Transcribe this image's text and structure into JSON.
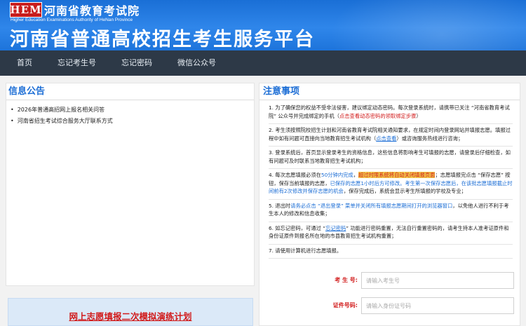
{
  "header": {
    "logo_text": "HEM",
    "org_name": "河南省教育考试院",
    "org_en": "Higher Education Examinations Authority of HeNan Province",
    "platform_title": "河南省普通高校招生考生服务平台"
  },
  "nav": {
    "items": [
      {
        "label": "首页"
      },
      {
        "label": "忘记考生号"
      },
      {
        "label": "忘记密码"
      },
      {
        "label": "微信公众号"
      }
    ]
  },
  "notices": {
    "title": "信息公告",
    "items": [
      {
        "label": "2026年普通高招网上报名相关问答"
      },
      {
        "label": "河南省招生考试综合服务大厅联系方式"
      }
    ]
  },
  "drill": {
    "label": "网上志愿填报二次模拟演练计划"
  },
  "rules": {
    "title": "注意事项",
    "r1": {
      "a": "1. 为了确保您的权益不受非法侵害，建议绑定动态密码。每次登录系统时，请携带已关注 “河南省教育考试院” 公众号并完成绑定的手机（",
      "b": "点击查看动态密码的领取绑定步骤",
      "c": "）"
    },
    "r2": {
      "a": "2. 考生须按照院校招生计划和河南省教育考试院相关通知要求，在规定时间内登录网站并填报志愿。填报过程中如有问题可直接向当地教育招生考试机构（",
      "b": "点击查看",
      "c": "）或咨询服务热线进行咨询；"
    },
    "r3": {
      "a": "3. 登录系统后，首页显示登录考生的资格信息，这些信息将影响考生可填报的志愿，请登录后仔细检查，如有问题可及时联系当地教育招生考试机构；"
    },
    "r4": {
      "a": "4. 每次志愿填报必须在",
      "b": "50分钟内完成",
      "c": "，",
      "d": "超过时限系统将自动关闭填报页面",
      "e": "；志愿填报完点击 “保存志愿” 按钮，保存当前填报的志愿，",
      "f": "已保存的志愿1小时后方可修改。考生第一次保存志愿后，在该批志愿填报截止时间前有2次修改并保存志愿的机会",
      "g": "，保存完成后，系统会显示考生所填报的学校及专业；"
    },
    "r5": {
      "a": "5. 退出时",
      "b": "请务必点击 “退出登录” 菜单并关闭所有填报志愿期间打开的浏览器窗口",
      "c": "，以免他人进行不利于考生本人的修改和信息收集；"
    },
    "r6": {
      "a": "6. 如忘记密码，可通过 “",
      "b": "忘记密码",
      "c": "” 功能进行密码重置，无法自行重置密码的，请考生持本人准考证原件和身份证原件到报名所在地的市县教育招生考试机构重置；"
    },
    "r7": {
      "a": "7. 请使用计算机进行志愿填报。"
    }
  },
  "login": {
    "exam_no_label": "考 生 号:",
    "exam_no_placeholder": "请输入考生号",
    "id_label": "证件号码:",
    "id_placeholder": "请输入身份证号码"
  },
  "colors": {
    "banner_blue": "#1d74db",
    "nav_bg": "#2d3947",
    "accent_blue": "#1b6dd5",
    "alert_red": "#d11a1a",
    "highlight_yellow": "#f2c94c"
  }
}
